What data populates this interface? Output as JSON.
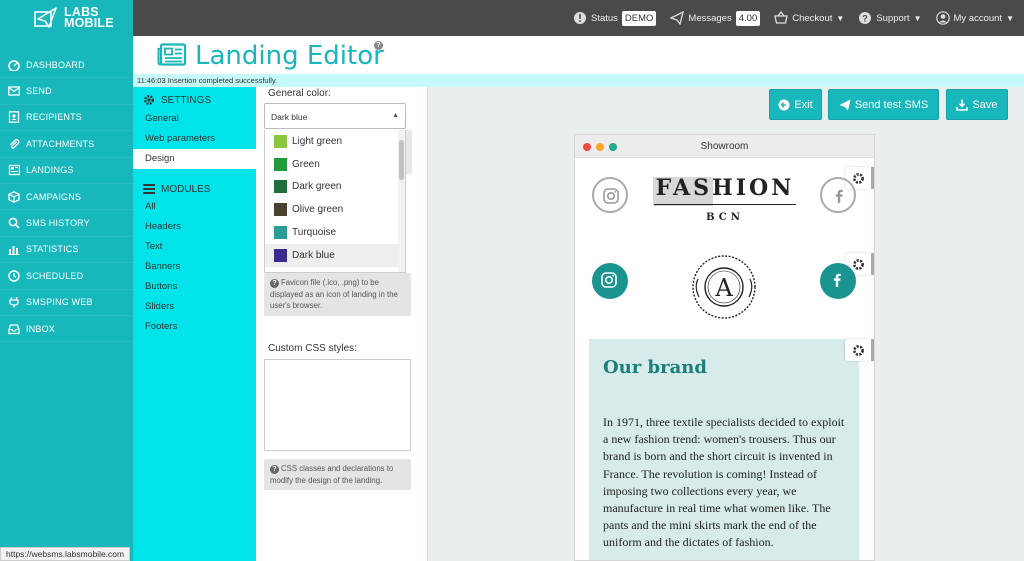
{
  "app": {
    "logo_line1": "LABS",
    "logo_line2": "MOBILE",
    "status_url": "https://websms.labsmobile.com"
  },
  "sidebar": {
    "items": [
      {
        "label": "DASHBOARD",
        "icon": "dashboard-icon"
      },
      {
        "label": "SEND",
        "icon": "envelope-icon"
      },
      {
        "label": "RECIPIENTS",
        "icon": "address-book-icon"
      },
      {
        "label": "ATTACHMENTS",
        "icon": "paperclip-icon"
      },
      {
        "label": "LANDINGS",
        "icon": "newspaper-icon"
      },
      {
        "label": "CAMPAIGNS",
        "icon": "cube-icon"
      },
      {
        "label": "SMS HISTORY",
        "icon": "search-icon"
      },
      {
        "label": "STATISTICS",
        "icon": "bar-chart-icon"
      },
      {
        "label": "SCHEDULED",
        "icon": "clock-icon"
      },
      {
        "label": "SMSPING WEB",
        "icon": "plug-icon"
      },
      {
        "label": "INBOX",
        "icon": "inbox-icon"
      }
    ]
  },
  "topbar": {
    "status_label": "Status",
    "status_value": "DEMO",
    "messages_label": "Messages",
    "messages_value": "4.00",
    "checkout_label": "Checkout",
    "support_label": "Support",
    "account_label": "My account"
  },
  "header": {
    "title": "Landing Editor",
    "notification": "11:46:03 Insertion completed successfully."
  },
  "settings": {
    "settings_heading": "SETTINGS",
    "settings_items": [
      "General",
      "Web parameters",
      "Design"
    ],
    "active_item": "Design",
    "modules_heading": "MODULES",
    "modules_items": [
      "All",
      "Headers",
      "Text",
      "Banners",
      "Buttons",
      "Sliders",
      "Footers"
    ]
  },
  "design_form": {
    "general_color_label": "General color:",
    "general_color_value": "Dark blue",
    "color_options": [
      {
        "label": "Light green",
        "color": "#8cc63f"
      },
      {
        "label": "Green",
        "color": "#1e9b3a"
      },
      {
        "label": "Dark green",
        "color": "#1f6e3e"
      },
      {
        "label": "Olive green",
        "color": "#4a4130"
      },
      {
        "label": "Turquoise",
        "color": "#2a9d96"
      },
      {
        "label": "Dark blue",
        "color": "#3b2a8f"
      }
    ],
    "favicon_hint": "Favicon file (.ico, .png) to be displayed as an icon of landing in the user's browser.",
    "css_label": "Custom CSS styles:",
    "css_value": "",
    "css_hint": "CSS classes and declarations to modify the design of the landing."
  },
  "toolbar": {
    "exit_label": "Exit",
    "send_test_label": "Send test SMS",
    "save_label": "Save"
  },
  "preview": {
    "window_title": "Showroom",
    "brand_name": "FASHION",
    "brand_city": "BCN",
    "seal_letter": "A",
    "seal_top_text": "PREMIUM QUALITY",
    "seal_bottom_text": "SINCE 1980",
    "section_title": "Our brand",
    "section_text": "In 1971, three textile specialists decided to exploit a new fashion trend: women's trousers. Thus our brand is born and the short circuit is invented in France. The revolution is coming! Instead of imposing two collections every year, we manufacture in real time what women like. The pants and the mini skirts mark the end of the uniform and the dictates of fashion."
  },
  "colors": {
    "brand": "#17b7bb",
    "settings_panel": "#00e4e9",
    "topbar": "#4a4a4a",
    "preview_accent": "#1a9490"
  }
}
